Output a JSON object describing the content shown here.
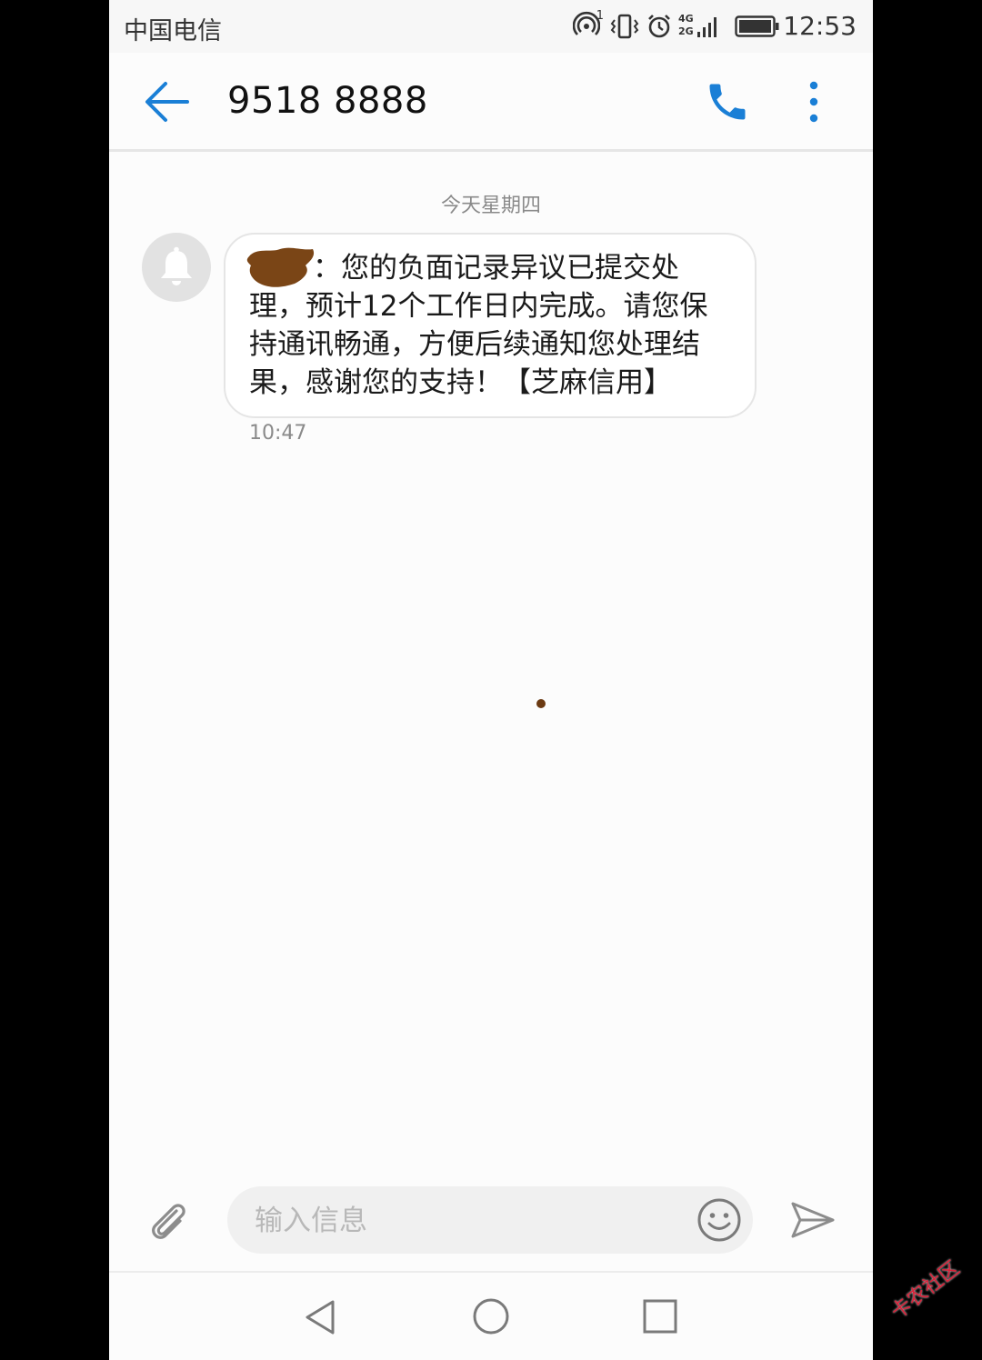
{
  "status_bar": {
    "carrier": "中国电信",
    "time": "12:53",
    "network_label_top": "4G",
    "network_label_bottom": "2G",
    "hotspot_sup": "1"
  },
  "header": {
    "contact_number": "9518 8888"
  },
  "conversation": {
    "date_separator": "今天星期四",
    "messages": [
      {
        "text": "：您的负面记录异议已提交处\n理，预计12个工作日内完成。请您保\n持通讯畅通，方便后续通知您处理结\n果，感谢您的支持！【芝麻信用】",
        "time": "10:47"
      }
    ]
  },
  "composer": {
    "placeholder": "输入信息",
    "value": ""
  },
  "watermark": {
    "text": "卡农社区"
  },
  "colors": {
    "accent": "#1a7fd6",
    "icon_gray": "#8c8c8c",
    "redaction": "#7a4516"
  }
}
